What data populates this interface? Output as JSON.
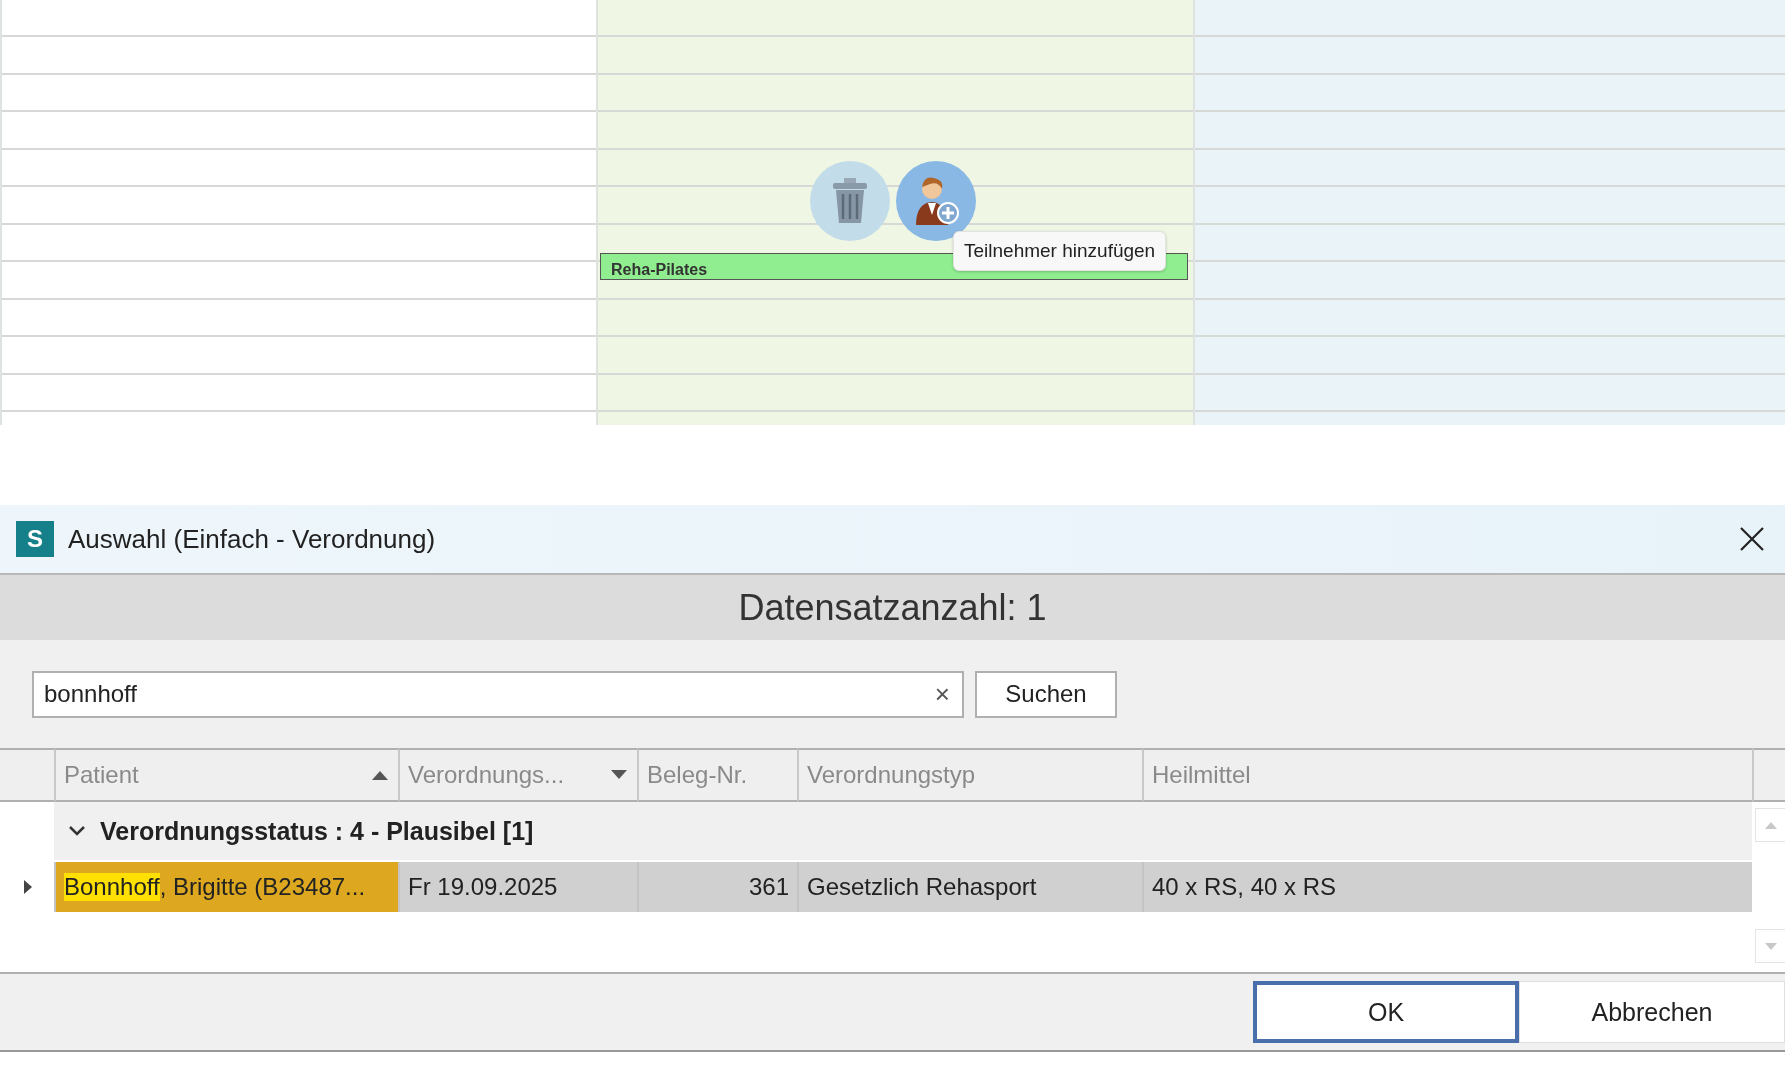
{
  "calendar": {
    "event": {
      "title": "Reha-Pilates"
    },
    "tooltip": "Teilnehmer hinzufügen"
  },
  "dialog": {
    "title": "Auswahl (Einfach - Verordnung)",
    "logo": "S",
    "record_count": "Datensatzanzahl: 1",
    "search": {
      "value": "bonnhoff",
      "clear": "×",
      "button": "Suchen"
    },
    "columns": [
      {
        "label": "Patient",
        "sorted_ascending": true,
        "sorted_descending": false
      },
      {
        "label": "Verordnungs...",
        "sorted_ascending": false,
        "sorted_descending": true
      },
      {
        "label": "Beleg-Nr.",
        "sorted_ascending": false,
        "sorted_descending": false
      },
      {
        "label": "Verordnungstyp",
        "sorted_ascending": false,
        "sorted_descending": false
      },
      {
        "label": "Heilmittel",
        "sorted_ascending": false,
        "sorted_descending": false
      }
    ],
    "group": {
      "label": "Verordnungsstatus : 4 - Plausibel [1]",
      "expanded": true
    },
    "rows": [
      {
        "patient_match": "Bonnhoff",
        "patient_rest": ", Brigitte (B23487...",
        "date": "Fr 19.09.2025",
        "beleg": "361",
        "typ": "Gesetzlich Rehasport",
        "heilmittel": "40 x RS, 40 x RS",
        "selected": true
      }
    ],
    "buttons": [
      {
        "label": "OK",
        "focused": true
      },
      {
        "label": "Abbrechen",
        "focused": false
      }
    ]
  }
}
